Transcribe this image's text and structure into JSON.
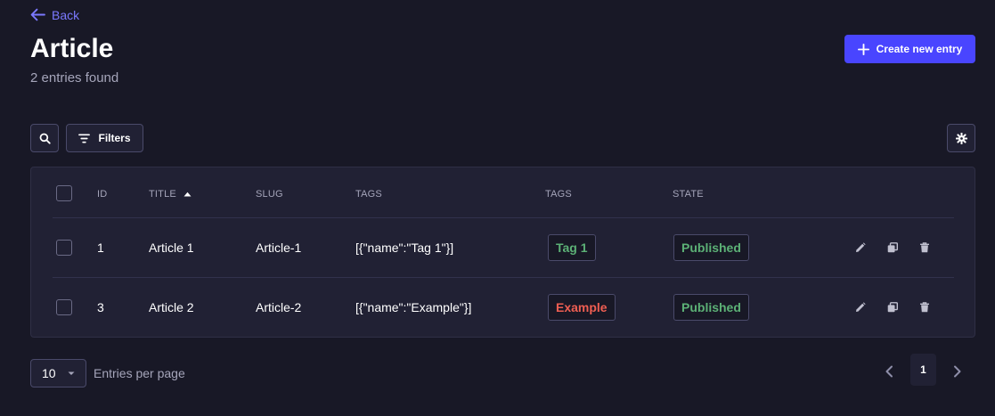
{
  "header": {
    "back_label": "Back",
    "title": "Article",
    "subtitle": "2 entries found",
    "create_label": "Create new entry"
  },
  "toolbar": {
    "filters_label": "Filters"
  },
  "table": {
    "columns": [
      "ID",
      "TITLE",
      "SLUG",
      "TAGS",
      "TAGS",
      "STATE"
    ],
    "sorted_column": "TITLE",
    "sort_direction": "ascending",
    "rows": [
      {
        "id": "1",
        "title": "Article 1",
        "slug": "Article-1",
        "tags_json": "[{\"name\":\"Tag 1\"}]",
        "tag_badge": "Tag 1",
        "tag_color": "#5cb176",
        "state": "Published",
        "state_color": "#5cb176"
      },
      {
        "id": "3",
        "title": "Article 2",
        "slug": "Article-2",
        "tags_json": "[{\"name\":\"Example\"}]",
        "tag_badge": "Example",
        "tag_color": "#ee5e52",
        "state": "Published",
        "state_color": "#5cb176"
      }
    ]
  },
  "pagination": {
    "per_page_value": "10",
    "per_page_label": "Entries per page",
    "current_page": "1"
  },
  "colors": {
    "accent": "#4945ff",
    "background": "#181826",
    "surface": "#212134",
    "published": "#5cb176",
    "danger": "#ee5e52"
  },
  "icons": {
    "back": "arrow-left-icon",
    "create": "plus-icon",
    "search": "search-icon",
    "filters": "filter-icon",
    "settings": "gear-icon",
    "sort": "caret-up-icon",
    "edit": "pencil-icon",
    "duplicate": "duplicate-icon",
    "delete": "trash-icon",
    "dropdown": "caret-down-icon",
    "prev": "chevron-left-icon",
    "next": "chevron-right-icon"
  }
}
